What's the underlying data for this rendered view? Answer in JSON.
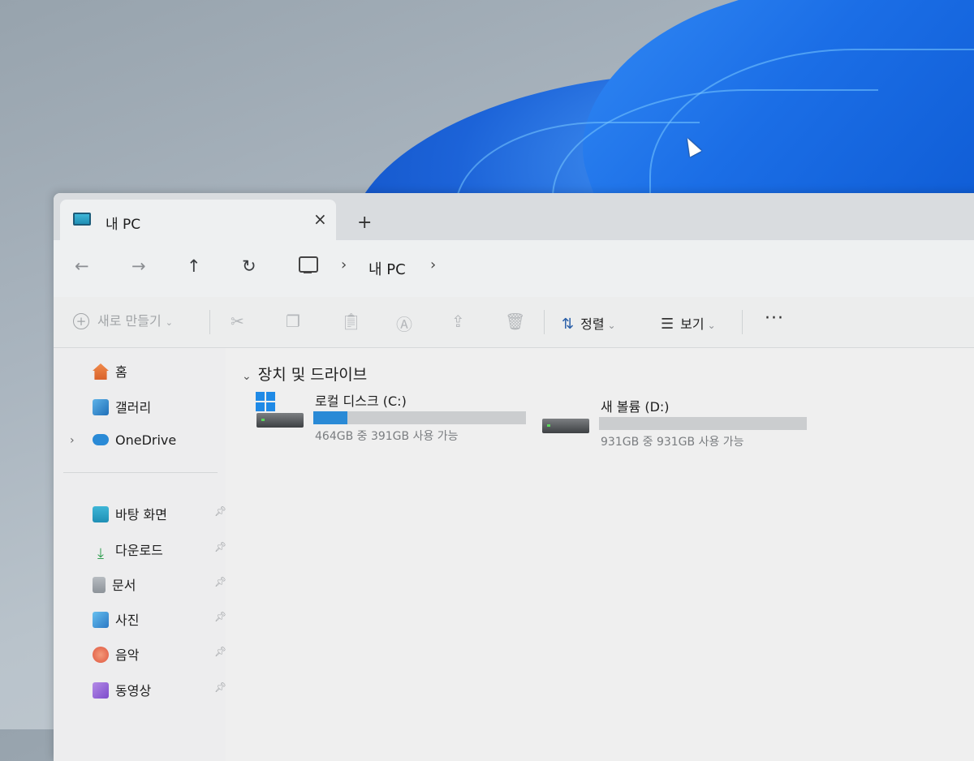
{
  "window": {
    "tab_title": "내 PC",
    "tab_close": "×",
    "new_tab": "+"
  },
  "nav": {
    "back": "←",
    "forward": "→",
    "up": "↑",
    "refresh": "↻",
    "breadcrumb_sep": "›",
    "breadcrumb": [
      "내 PC"
    ]
  },
  "toolbar": {
    "new_label": "새로 만들기",
    "sort_label": "정렬",
    "view_label": "보기",
    "more": "···",
    "icons": [
      "cut-icon",
      "copy-icon",
      "paste-icon",
      "rename-icon",
      "share-icon",
      "delete-icon"
    ]
  },
  "sidebar": {
    "top_items": [
      {
        "label": "홈",
        "icon": "home-icon"
      },
      {
        "label": "갤러리",
        "icon": "gallery-icon"
      },
      {
        "label": "OneDrive",
        "icon": "cloud-icon"
      }
    ],
    "pinned": [
      {
        "label": "바탕 화면",
        "icon": "desktop-icon"
      },
      {
        "label": "다운로드",
        "icon": "download-icon"
      },
      {
        "label": "문서",
        "icon": "document-icon"
      },
      {
        "label": "사진",
        "icon": "pictures-icon"
      },
      {
        "label": "음악",
        "icon": "music-icon"
      },
      {
        "label": "동영상",
        "icon": "video-icon"
      }
    ]
  },
  "content": {
    "group_title": "장치 및 드라이브",
    "drives": [
      {
        "name": "로컬 디스크 (C:)",
        "space": "464GB 중 391GB 사용 가능",
        "used_fraction": 0.16
      },
      {
        "name": "새 볼륨 (D:)",
        "space": "931GB 중 931GB 사용 가능",
        "used_fraction": 0.0
      }
    ]
  },
  "colors": {
    "accent": "#2a8ad6",
    "wallpaper_blue": "#1b6ee6"
  }
}
